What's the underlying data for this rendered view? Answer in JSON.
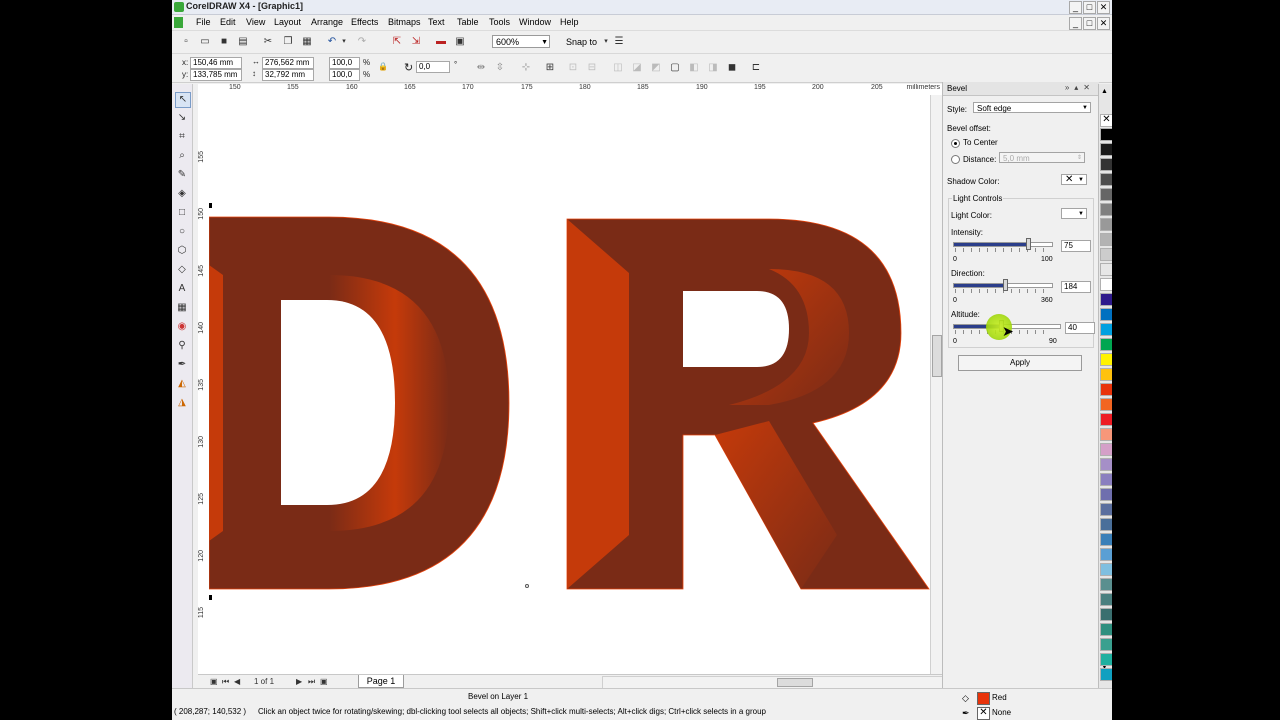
{
  "window": {
    "title": "CorelDRAW X4 - [Graphic1]",
    "buttons": [
      "_",
      "□",
      "✕"
    ]
  },
  "doc_window_buttons": [
    "_",
    "□",
    "✕"
  ],
  "menu": [
    "File",
    "Edit",
    "View",
    "Layout",
    "Arrange",
    "Effects",
    "Bitmaps",
    "Text",
    "Table",
    "Tools",
    "Window",
    "Help"
  ],
  "toolbar": {
    "zoom": "600%",
    "snap": "Snap to"
  },
  "propbar": {
    "x": "150,46 mm",
    "y": "133,785 mm",
    "w": "276,562 mm",
    "h": "32,792 mm",
    "sx": "100,0",
    "sy": "100,0",
    "pct": "%",
    "rotation": "0,0",
    "deg": "°",
    "x_label": "x:",
    "y_label": "y:"
  },
  "ruler": {
    "h_ticks": [
      "150",
      "155",
      "160",
      "165",
      "170",
      "175",
      "180",
      "185",
      "190",
      "195",
      "200",
      "205"
    ],
    "v_ticks": [
      "155",
      "150",
      "145",
      "140",
      "135",
      "130",
      "125",
      "120",
      "115"
    ],
    "unit": "millimeters"
  },
  "artwork": {
    "letters": "DR",
    "dark_color": "#7a2b16",
    "light_color": "#c53a0a"
  },
  "pagenav": {
    "count": "1 of 1",
    "page_tab": "Page 1"
  },
  "status": {
    "layer": "Bevel on Layer 1",
    "coords": "( 208,287; 140,532 )",
    "hint": "Click an object twice for rotating/skewing; dbl-clicking tool selects all objects; Shift+click multi-selects; Alt+click digs; Ctrl+click selects in a group",
    "fill_name": "Red",
    "fill_color": "#e8330a",
    "outline_name": "None"
  },
  "docker": {
    "title": "Bevel",
    "style_label": "Style:",
    "style_value": "Soft edge",
    "bevel_offset_label": "Bevel offset:",
    "to_center": "To Center",
    "distance_label": "Distance:",
    "distance_value": "5,0 mm",
    "shadow_color_label": "Shadow Color:",
    "light_controls": "Light Controls",
    "light_color_label": "Light Color:",
    "intensity_label": "Intensity:",
    "intensity_value": "75",
    "intensity_min": "0",
    "intensity_max": "100",
    "direction_label": "Direction:",
    "direction_value": "184",
    "direction_min": "0",
    "direction_max": "360",
    "altitude_label": "Altitude:",
    "altitude_value": "40",
    "altitude_min": "0",
    "altitude_max": "90",
    "apply": "Apply"
  },
  "palette_colors": [
    "#000000",
    "#1a1a1a",
    "#333333",
    "#4d4d4d",
    "#666666",
    "#808080",
    "#999999",
    "#b3b3b3",
    "#cccccc",
    "#e6e6e6",
    "#ffffff",
    "#2e1a8c",
    "#0070c0",
    "#00a0e0",
    "#00a651",
    "#fff200",
    "#ffc20e",
    "#e8330a",
    "#f26522",
    "#ed1c24",
    "#f7977a",
    "#d4a0c8",
    "#a58fc7",
    "#8a7fbf",
    "#6f6fae",
    "#5a6e9e",
    "#4a6f9a",
    "#3a7fb8",
    "#5a9fd4",
    "#7fbfe0",
    "#5a8f8f",
    "#4a7f7f",
    "#3a6f6f",
    "#2f8f7f",
    "#3aa08f",
    "#20b0a0",
    "#10a0c0"
  ]
}
